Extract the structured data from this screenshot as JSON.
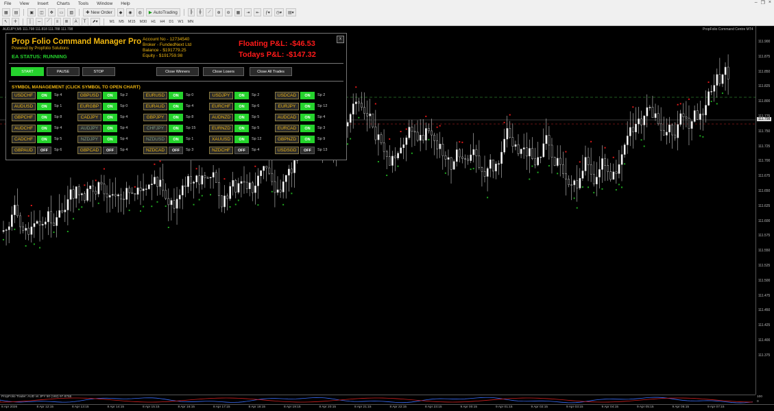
{
  "menu": [
    "File",
    "View",
    "Insert",
    "Charts",
    "Tools",
    "Window",
    "Help"
  ],
  "toolbar": {
    "new_order": "New Order",
    "autotrading": "AutoTrading"
  },
  "timeframes": [
    "M1",
    "M5",
    "M15",
    "M30",
    "H1",
    "H4",
    "D1",
    "W1",
    "MN"
  ],
  "chart": {
    "symbol_title": "AUDJPY,M5  111.798 111.818 111.788 111.798",
    "brand": "PropFolio Command Centre MT4",
    "indicator_label": "PropFolio Trader: AUD vs JPY 50 (182) 97.8766",
    "price_labels": [
      "111.900",
      "111.875",
      "111.850",
      "111.825",
      "111.800",
      "111.775",
      "111.750",
      "111.725",
      "111.700",
      "111.675",
      "111.650",
      "111.625",
      "111.600",
      "111.575",
      "111.550",
      "111.525",
      "111.500",
      "111.475",
      "111.450",
      "111.425",
      "111.400",
      "111.375"
    ],
    "current_price_tag": "111.798",
    "ind_scale": [
      "100",
      "0"
    ],
    "time_labels": [
      "8 Apr 2026",
      "8 Apr 12:15",
      "8 Apr 13:15",
      "8 Apr 14:15",
      "8 Apr 15:15",
      "8 Apr 16:15",
      "8 Apr 17:15",
      "8 Apr 18:15",
      "8 Apr 19:15",
      "8 Apr 20:15",
      "8 Apr 21:15",
      "8 Apr 22:15",
      "8 Apr 23:15",
      "9 Apr 00:15",
      "9 Apr 01:15",
      "9 Apr 02:15",
      "9 Apr 03:15",
      "9 Apr 04:15",
      "9 Apr 05:15",
      "9 Apr 06:15",
      "9 Apr 07:15"
    ]
  },
  "panel": {
    "title": "Prop Folio Command Manager Pro",
    "subtitle": "Powered by Propfolio Solutions",
    "status": "EA STATUS: RUNNING",
    "account_no": "Account No - 12734540",
    "broker": "Broker - FundedNext Ltd",
    "balance": "Balance - $191779.25",
    "equity": "Equity - $191759.98",
    "floating_pnl": "Floating P&L: -$46.53",
    "todays_pnl": "Todays P&L: -$147.32",
    "close_x": "x",
    "buttons": {
      "start": "START",
      "pause": "PAUSE",
      "stop": "STOP",
      "close_winners": "Close Winners",
      "close_losers": "Close Losers",
      "close_all": "Close All Trades"
    },
    "symbol_header": "SYMBOL MANAGEMENT (CLICK SYMBOL TO OPEN CHART)",
    "symbols": [
      [
        {
          "s": "USDCHF",
          "t": "ON",
          "sp": "Sp 4"
        },
        {
          "s": "GBPUSD",
          "t": "ON",
          "sp": "Sp 2"
        },
        {
          "s": "EURUSD",
          "t": "ON",
          "sp": "Sp 0"
        },
        {
          "s": "USDJPY",
          "t": "ON",
          "sp": "Sp 2"
        },
        {
          "s": "USDCAD",
          "t": "ON",
          "sp": "Sp 2"
        }
      ],
      [
        {
          "s": "AUDUSD",
          "t": "ON",
          "sp": "Sp 1"
        },
        {
          "s": "EURGBP",
          "t": "ON",
          "sp": "Sp 0"
        },
        {
          "s": "EURAUD",
          "t": "ON",
          "sp": "Sp 4"
        },
        {
          "s": "EURCHF",
          "t": "ON",
          "sp": "Sp 6"
        },
        {
          "s": "EURJPY",
          "t": "ON",
          "sp": "Sp 12"
        }
      ],
      [
        {
          "s": "GBPCHF",
          "t": "ON",
          "sp": "Sp 8"
        },
        {
          "s": "CADJPY",
          "t": "ON",
          "sp": "Sp 4"
        },
        {
          "s": "GBPJPY",
          "t": "ON",
          "sp": "Sp 8"
        },
        {
          "s": "AUDNZD",
          "t": "ON",
          "sp": "Sp 5"
        },
        {
          "s": "AUDCAD",
          "t": "ON",
          "sp": "Sp 4"
        }
      ],
      [
        {
          "s": "AUDCHF",
          "t": "ON",
          "sp": "Sp 4"
        },
        {
          "s": "AUDJPY",
          "t": "ON",
          "sp": "Sp 4",
          "dim": true
        },
        {
          "s": "CHFJPY",
          "t": "ON",
          "sp": "Sp 15",
          "dim": true
        },
        {
          "s": "EURNZD",
          "t": "ON",
          "sp": "Sp 5"
        },
        {
          "s": "EURCAD",
          "t": "ON",
          "sp": "Sp 3"
        }
      ],
      [
        {
          "s": "CADCHF",
          "t": "ON",
          "sp": "Sp 5"
        },
        {
          "s": "NZDJPY",
          "t": "ON",
          "sp": "Sp 4",
          "dim": true
        },
        {
          "s": "NZDUSD",
          "t": "ON",
          "sp": "Sp 1",
          "dim": true
        },
        {
          "s": "XAUUSD",
          "t": "ON",
          "sp": "Sp 12"
        },
        {
          "s": "GBPNZD",
          "t": "ON",
          "sp": "Sp 9"
        }
      ],
      [
        {
          "s": "GBPAUD",
          "t": "OFF",
          "sp": "Sp 6"
        },
        {
          "s": "GBPCAD",
          "t": "OFF",
          "sp": "Sp 4"
        },
        {
          "s": "NZDCAD",
          "t": "OFF",
          "sp": "Sp 3"
        },
        {
          "s": "NZDCHF",
          "t": "OFF",
          "sp": "Sp 4"
        },
        {
          "s": "USDSGD",
          "t": "OFF",
          "sp": "Sp 13"
        }
      ]
    ]
  }
}
